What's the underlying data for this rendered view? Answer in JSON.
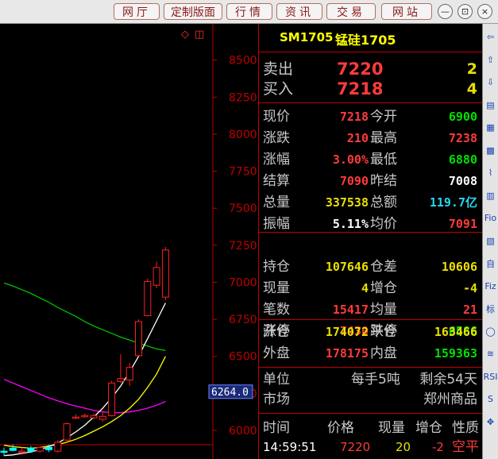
{
  "topbar": {
    "buttons": [
      "网厅",
      "定制版面",
      "行情",
      "资讯",
      "交易",
      "网站"
    ],
    "window_controls": [
      "—",
      "⊡",
      "×"
    ]
  },
  "chart": {
    "price_axis": [
      "8500",
      "8250",
      "8000",
      "7750",
      "7500",
      "7250",
      "7000",
      "6750",
      "6500",
      "6250",
      "6000"
    ],
    "current_price_tag": "6264.0",
    "marker_icons": [
      "◇",
      "◫"
    ],
    "colors": {
      "up": "#ff2020",
      "down": "#00ffff",
      "ma_white": "#ffffff",
      "ma_yellow": "#ffff00",
      "ma_purple": "#ff00ff",
      "ma_green": "#00c000",
      "axis": "#c00000"
    }
  },
  "chart_data": {
    "type": "candlestick",
    "ylim": [
      5850,
      8600
    ],
    "candles": [
      {
        "o": 5860,
        "h": 5885,
        "l": 5830,
        "c": 5855
      },
      {
        "o": 5880,
        "h": 5905,
        "l": 5860,
        "c": 5865
      },
      {
        "o": 5855,
        "h": 5885,
        "l": 5835,
        "c": 5860
      },
      {
        "o": 5880,
        "h": 5895,
        "l": 5850,
        "c": 5860
      },
      {
        "o": 5860,
        "h": 5890,
        "l": 5850,
        "c": 5885
      },
      {
        "o": 5885,
        "h": 5905,
        "l": 5855,
        "c": 5870
      },
      {
        "o": 5860,
        "h": 5935,
        "l": 5850,
        "c": 5920
      },
      {
        "o": 5935,
        "h": 6055,
        "l": 5920,
        "c": 6045
      },
      {
        "o": 6085,
        "h": 6110,
        "l": 6075,
        "c": 6090
      },
      {
        "o": 6095,
        "h": 6115,
        "l": 6085,
        "c": 6100
      },
      {
        "o": 6085,
        "h": 6115,
        "l": 6075,
        "c": 6100
      },
      {
        "o": 6075,
        "h": 6130,
        "l": 6060,
        "c": 6095
      },
      {
        "o": 6100,
        "h": 6335,
        "l": 6095,
        "c": 6320
      },
      {
        "o": 6330,
        "h": 6515,
        "l": 6320,
        "c": 6350
      },
      {
        "o": 6340,
        "h": 6455,
        "l": 6300,
        "c": 6425
      },
      {
        "o": 6505,
        "h": 6750,
        "l": 6500,
        "c": 6735
      },
      {
        "o": 6775,
        "h": 7025,
        "l": 6770,
        "c": 7005
      },
      {
        "o": 6980,
        "h": 7140,
        "l": 6960,
        "c": 7100
      },
      {
        "o": 6900,
        "h": 7238,
        "l": 6880,
        "c": 7218
      }
    ],
    "ma_white": [
      5830,
      5835,
      5845,
      5855,
      5870,
      5890,
      5915,
      5950,
      5990,
      6035,
      6090,
      6150,
      6220,
      6300,
      6395,
      6500,
      6620,
      6740,
      6860
    ],
    "ma_yellow": [
      5900,
      5890,
      5885,
      5880,
      5885,
      5895,
      5905,
      5920,
      5940,
      5965,
      5995,
      6025,
      6060,
      6100,
      6150,
      6210,
      6290,
      6380,
      6500
    ],
    "ma_purple": [
      6345,
      6320,
      6295,
      6270,
      6245,
      6220,
      6200,
      6180,
      6165,
      6150,
      6135,
      6125,
      6120,
      6120,
      6125,
      6135,
      6150,
      6170,
      6195
    ],
    "ma_green": [
      6995,
      6975,
      6950,
      6925,
      6895,
      6865,
      6830,
      6800,
      6770,
      6735,
      6705,
      6680,
      6655,
      6630,
      6610,
      6590,
      6570,
      6550,
      6540
    ]
  },
  "quote": {
    "header": {
      "code": "SM1705",
      "name": "锰硅1705"
    },
    "sell": {
      "label": "卖出",
      "price": "7220",
      "qty": "2"
    },
    "buy": {
      "label": "买入",
      "price": "7218",
      "qty": "4"
    },
    "rows_a": [
      {
        "l1": "现价",
        "v1": "7218",
        "c1": "red",
        "l2": "今开",
        "v2": "6900",
        "c2": "green"
      },
      {
        "l1": "涨跌",
        "v1": "210",
        "c1": "red",
        "l2": "最高",
        "v2": "7238",
        "c2": "red"
      },
      {
        "l1": "涨幅",
        "v1": "3.00%",
        "c1": "red",
        "l2": "最低",
        "v2": "6880",
        "c2": "green"
      },
      {
        "l1": "结算",
        "v1": "7090",
        "c1": "red",
        "l2": "昨结",
        "v2": "7008",
        "c2": "white"
      },
      {
        "l1": "总量",
        "v1": "337538",
        "c1": "yellow",
        "l2": "总额",
        "v2": "119.7亿",
        "c2": "cyan"
      },
      {
        "l1": "振幅",
        "v1": "5.11%",
        "c1": "white",
        "l2": "均价",
        "v2": "7091",
        "c2": "red"
      }
    ],
    "rows_b": [
      {
        "l1": "持仓",
        "v1": "107646",
        "c1": "yellow",
        "l2": "仓差",
        "v2": "10606",
        "c2": "yellow"
      },
      {
        "l1": "现量",
        "v1": "4",
        "c1": "yellow",
        "l2": "增仓",
        "v2": "-4",
        "c2": "yellow"
      },
      {
        "l1": "笔数",
        "v1": "15417",
        "c1": "red",
        "l2": "均量",
        "v2": "21",
        "c2": "red"
      },
      {
        "l1": "涨停",
        "v1": "7430",
        "c1": "red",
        "l2": "跌停",
        "v2": "6586",
        "c2": "green"
      }
    ],
    "rows_c": [
      {
        "l1": "开仓",
        "v1": "174072",
        "c1": "yellow",
        "l2": "平仓",
        "v2": "163466",
        "c2": "yellow"
      },
      {
        "l1": "外盘",
        "v1": "178175",
        "c1": "red",
        "l2": "内盘",
        "v2": "159363",
        "c2": "green"
      }
    ],
    "info": {
      "unit_label": "单位",
      "unit_value": "每手5吨",
      "remain": "剩余54天",
      "market_label": "市场",
      "market_value": "郑州商品"
    },
    "ticks": {
      "headers": [
        "时间",
        "价格",
        "现量",
        "增仓",
        "性质"
      ],
      "row": [
        "14:59:51",
        "7220",
        "20",
        "-2",
        "空平"
      ]
    }
  },
  "sidebar": {
    "icons": [
      "⇦",
      "⇧",
      "⇩",
      "▤",
      "▦",
      "▩",
      "⌇",
      "▥",
      "Fio",
      "▧",
      "自",
      "Fiz",
      "标",
      "◯",
      "≋",
      "RSI",
      "S",
      "✥"
    ]
  }
}
